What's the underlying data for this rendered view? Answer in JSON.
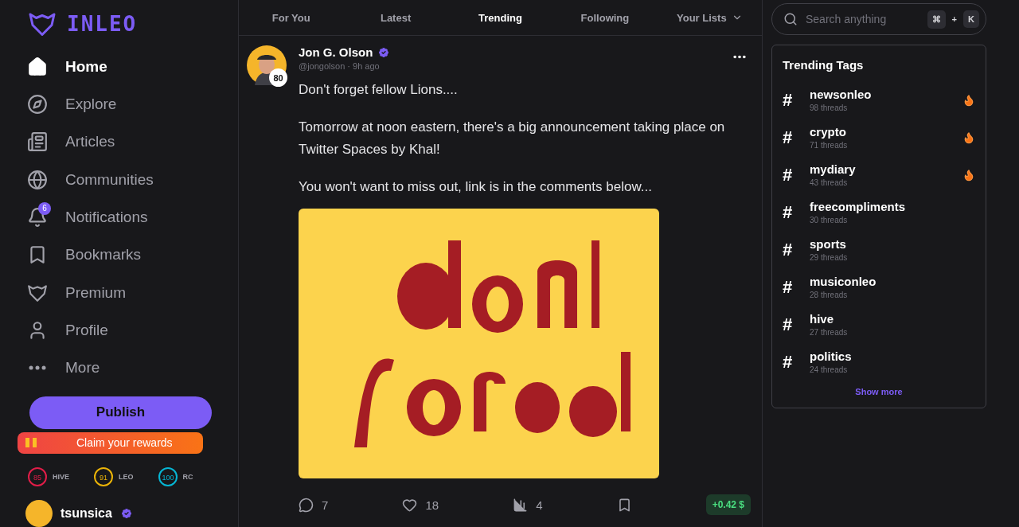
{
  "logo": {
    "text": "INLEO"
  },
  "nav": [
    {
      "label": "Home",
      "selected": true
    },
    {
      "label": "Explore",
      "selected": false
    },
    {
      "label": "Articles",
      "selected": false
    },
    {
      "label": "Communities",
      "selected": false
    },
    {
      "label": "Notifications",
      "selected": false,
      "badge": "6"
    },
    {
      "label": "Bookmarks",
      "selected": false
    },
    {
      "label": "Premium",
      "selected": false
    },
    {
      "label": "Profile",
      "selected": false
    },
    {
      "label": "More",
      "selected": false
    }
  ],
  "publish_button": "Publish",
  "claim_button": "Claim your rewards",
  "meters": [
    {
      "value": "85",
      "label": "HIVE",
      "color": "#e11d48"
    },
    {
      "value": "91",
      "label": "LEO",
      "color": "#eab308"
    },
    {
      "value": "100",
      "label": "RC",
      "color": "#06b6d4"
    }
  ],
  "account": {
    "name": "tsunsica",
    "verified": true
  },
  "tabs": [
    {
      "label": "For You",
      "selected": false
    },
    {
      "label": "Latest",
      "selected": false
    },
    {
      "label": "Trending",
      "selected": true
    },
    {
      "label": "Following",
      "selected": false
    },
    {
      "label": "Your Lists",
      "selected": false,
      "dropdown": true
    }
  ],
  "post": {
    "author": "Jon G. Olson",
    "verified": true,
    "reputation": "80",
    "handle": "@jongolson",
    "separator": "·",
    "time": "9h ago",
    "paragraphs": [
      "Don't forget fellow Lions....",
      "Tomorrow at noon eastern, there's a big announcement taking place on Twitter Spaces by Khal!",
      "You won't want to miss out, link is in the comments below..."
    ],
    "comments": "7",
    "likes": "18",
    "votes": "4",
    "bookmarked": false,
    "payout": "+0.42 $"
  },
  "search": {
    "placeholder": "Search anything",
    "shortcut": [
      "⌘",
      "+",
      "K"
    ]
  },
  "trending": {
    "title": "Trending Tags",
    "tags": [
      {
        "hash": "#",
        "name": "newsonleo",
        "count": "98 threads",
        "hot": true
      },
      {
        "hash": "#",
        "name": "crypto",
        "count": "71 threads",
        "hot": true
      },
      {
        "hash": "#",
        "name": "mydiary",
        "count": "43 threads",
        "hot": true
      },
      {
        "hash": "#",
        "name": "freecompliments",
        "count": "30 threads",
        "hot": false
      },
      {
        "hash": "#",
        "name": "sports",
        "count": "29 threads",
        "hot": false
      },
      {
        "hash": "#",
        "name": "musiconleo",
        "count": "28 threads",
        "hot": false
      },
      {
        "hash": "#",
        "name": "hive",
        "count": "27 threads",
        "hot": false
      },
      {
        "hash": "#",
        "name": "politics",
        "count": "24 threads",
        "hot": false
      }
    ],
    "show_more": "Show more"
  }
}
